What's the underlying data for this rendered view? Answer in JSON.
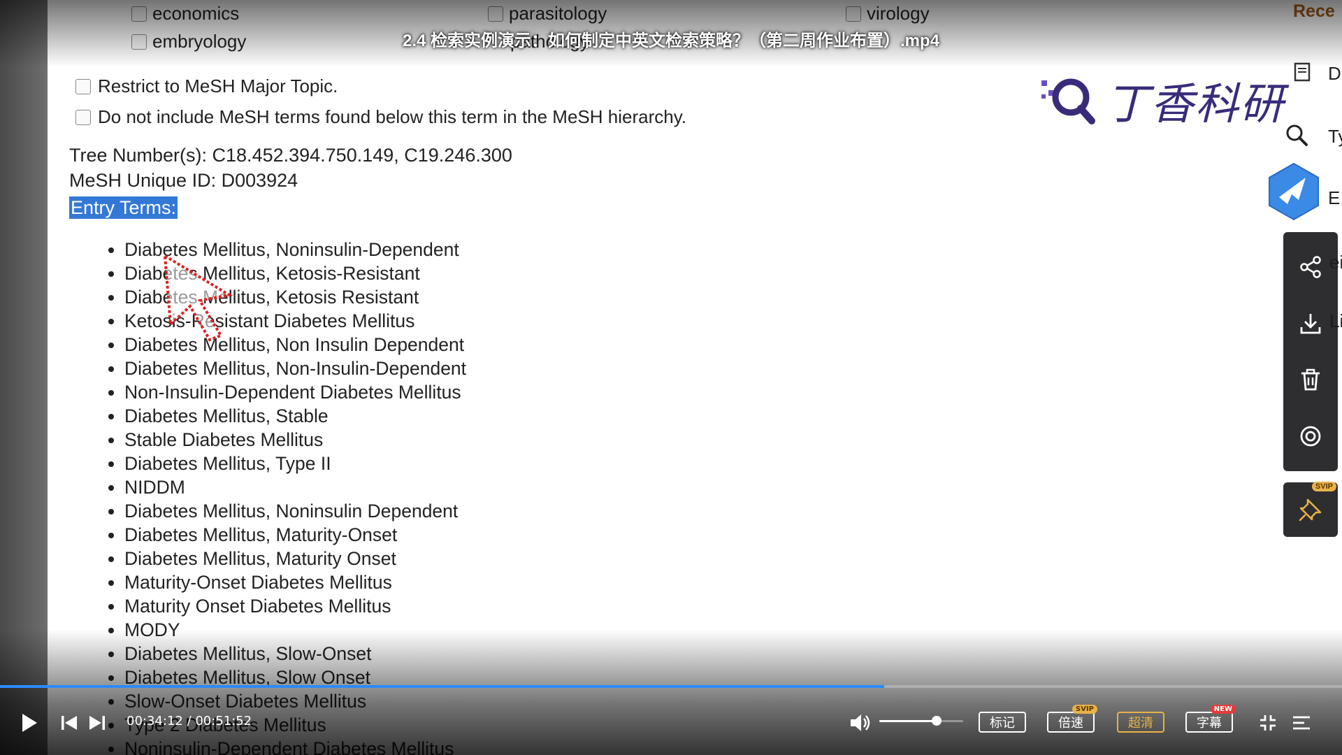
{
  "video": {
    "title": "2.4 检索实例演示：如何制定中英文检索策略？（第二周作业布置）.mp4"
  },
  "subjects": [
    {
      "label": "economics"
    },
    {
      "label": "parasitology"
    },
    {
      "label": "virology"
    },
    {
      "label": "embryology"
    },
    {
      "label": "pathology"
    }
  ],
  "options": {
    "major_topic": "Restrict to MeSH Major Topic.",
    "no_below": "Do not include MeSH terms found below this term in the MeSH hierarchy."
  },
  "meta": {
    "tree_numbers": "Tree Number(s): C18.452.394.750.149, C19.246.300",
    "unique_id": "MeSH Unique ID: D003924",
    "entry_terms_label": "Entry Terms:"
  },
  "entry_terms": [
    "Diabetes Mellitus, Noninsulin-Dependent",
    "Diabetes Mellitus, Ketosis-Resistant",
    "Diabetes Mellitus, Ketosis Resistant",
    "Ketosis-Resistant Diabetes Mellitus",
    "Diabetes Mellitus, Non Insulin Dependent",
    "Diabetes Mellitus, Non-Insulin-Dependent",
    "Non-Insulin-Dependent Diabetes Mellitus",
    "Diabetes Mellitus, Stable",
    "Stable Diabetes Mellitus",
    "Diabetes Mellitus, Type II",
    "NIDDM",
    "Diabetes Mellitus, Noninsulin Dependent",
    "Diabetes Mellitus, Maturity-Onset",
    "Diabetes Mellitus, Maturity Onset",
    "Maturity-Onset Diabetes Mellitus",
    "Maturity Onset Diabetes Mellitus",
    "MODY",
    "Diabetes Mellitus, Slow-Onset",
    "Diabetes Mellitus, Slow Onset",
    "Slow-Onset Diabetes Mellitus",
    "Type 2 Diabetes Mellitus",
    "Noninsulin-Dependent Diabetes Mellitus"
  ],
  "watermark": {
    "brand": "丁香科研"
  },
  "edge_fragments": {
    "recent": "Rece",
    "d": "D",
    "ty": "Ty",
    "e": "E",
    "ei": "ei",
    "li": "Li"
  },
  "player": {
    "time": "00:34:12 / 00:51:52",
    "progress": 0.659,
    "volume": 0.68,
    "mark_label": "标记",
    "speed_label": "倍速",
    "quality_label": "超清",
    "subtitle_label": "字幕",
    "svip_tag": "SVIP",
    "new_tag": "NEW",
    "accent_color": "#2a8cff",
    "vip_color": "#e8b24a"
  },
  "side_tools": {
    "pin_tag": "SVIP"
  }
}
